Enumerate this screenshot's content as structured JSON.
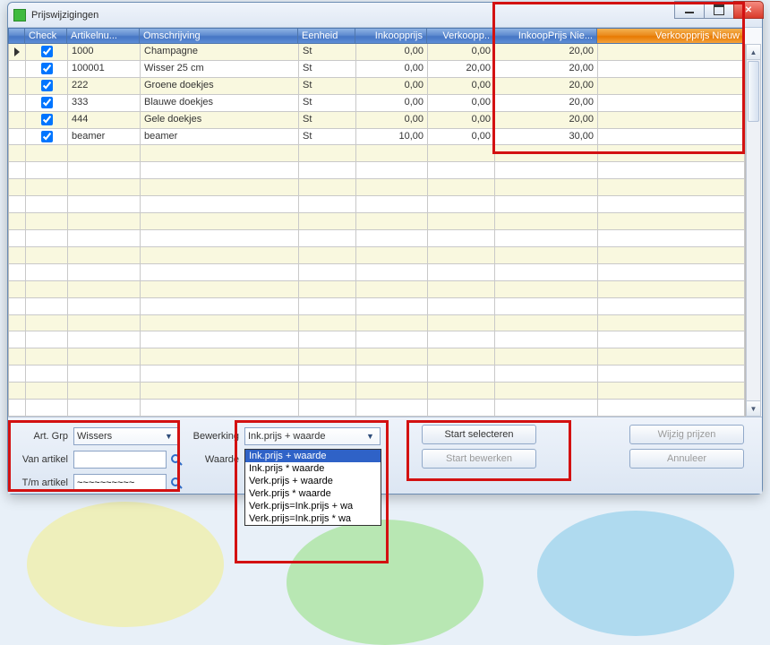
{
  "window": {
    "title": "Prijswijzigingen"
  },
  "headers": {
    "rowind": "",
    "check": "Check",
    "artnr": "Artikelnu...",
    "oms": "Omschrijving",
    "eenh": "Eenheid",
    "inkoop": "Inkoopprijs",
    "verkoop": "Verkoopp..",
    "inknew": "InkoopPrijs Nie...",
    "verknew": "Verkoopprijs Nieuw"
  },
  "rows": [
    {
      "artnr": "1000",
      "oms": "Champagne",
      "eenh": "St",
      "inkoop": "0,00",
      "verkoop": "0,00",
      "inknew": "20,00",
      "verknew": ""
    },
    {
      "artnr": "100001",
      "oms": "Wisser 25 cm",
      "eenh": "St",
      "inkoop": "0,00",
      "verkoop": "20,00",
      "inknew": "20,00",
      "verknew": ""
    },
    {
      "artnr": "222",
      "oms": "Groene doekjes",
      "eenh": "St",
      "inkoop": "0,00",
      "verkoop": "0,00",
      "inknew": "20,00",
      "verknew": ""
    },
    {
      "artnr": "333",
      "oms": "Blauwe doekjes",
      "eenh": "St",
      "inkoop": "0,00",
      "verkoop": "0,00",
      "inknew": "20,00",
      "verknew": ""
    },
    {
      "artnr": "444",
      "oms": "Gele doekjes",
      "eenh": "St",
      "inkoop": "0,00",
      "verkoop": "0,00",
      "inknew": "20,00",
      "verknew": ""
    },
    {
      "artnr": "beamer",
      "oms": "beamer",
      "eenh": "St",
      "inkoop": "10,00",
      "verkoop": "0,00",
      "inknew": "30,00",
      "verknew": ""
    }
  ],
  "footer": {
    "artgrp_label": "Art. Grp",
    "artgrp_value": "Wissers",
    "van_label": "Van artikel",
    "van_value": "",
    "tm_label": "T/m artikel",
    "tm_value": "~~~~~~~~~~",
    "bewerking_label": "Bewerking",
    "bewerking_value": "Ink.prijs + waarde",
    "waarde_label": "Waarde",
    "btn_start_sel": "Start selecteren",
    "btn_start_bew": "Start bewerken",
    "btn_wijzig": "Wijzig prijzen",
    "btn_annuleer": "Annuleer"
  },
  "dropdown": {
    "options": [
      "Ink.prijs + waarde",
      "Ink.prijs * waarde",
      "Verk.prijs + waarde",
      "Verk.prijs * waarde",
      "Verk.prijs=Ink.prijs + wa",
      "Verk.prijs=Ink.prijs * wa"
    ],
    "selected_index": 0
  },
  "colwidths": {
    "rowind": 19,
    "chk": 47,
    "artnr": 81,
    "oms": 177,
    "eenh": 64,
    "inkoop": 80,
    "verkoop": 75,
    "inknew": 115,
    "verknew": 164
  }
}
